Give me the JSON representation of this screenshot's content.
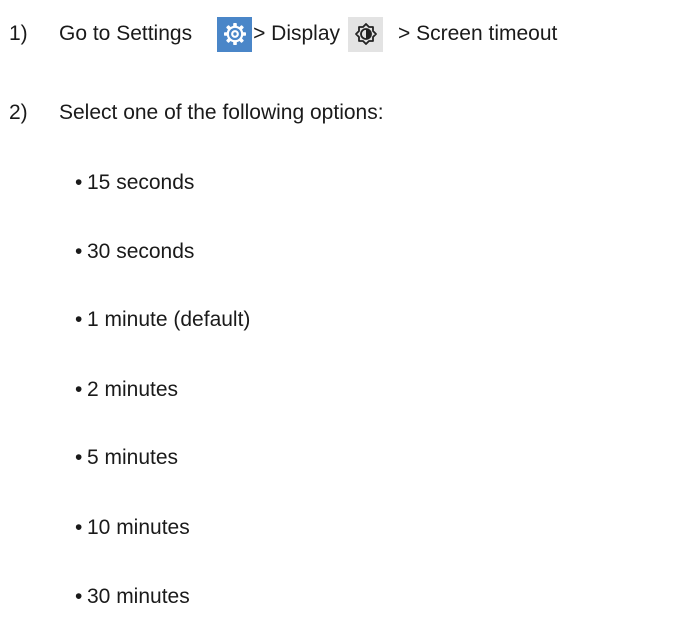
{
  "steps": [
    {
      "number": "1)",
      "prefix": "Go to Settings",
      "settings_icon": "gear-icon",
      "middle": "> Display",
      "display_icon": "brightness-icon",
      "suffix": "> Screen timeout"
    },
    {
      "number": "2)",
      "text": "Select one of the following options:"
    }
  ],
  "options": [
    "15 seconds",
    "30 seconds",
    "1 minute (default)",
    "2 minutes",
    "5 minutes",
    "10 minutes",
    "30 minutes"
  ],
  "bullet": "•",
  "colors": {
    "settings_icon_bg": "#4a86c8",
    "display_icon_bg": "#e3e3e3",
    "text": "#1a1a1a"
  }
}
